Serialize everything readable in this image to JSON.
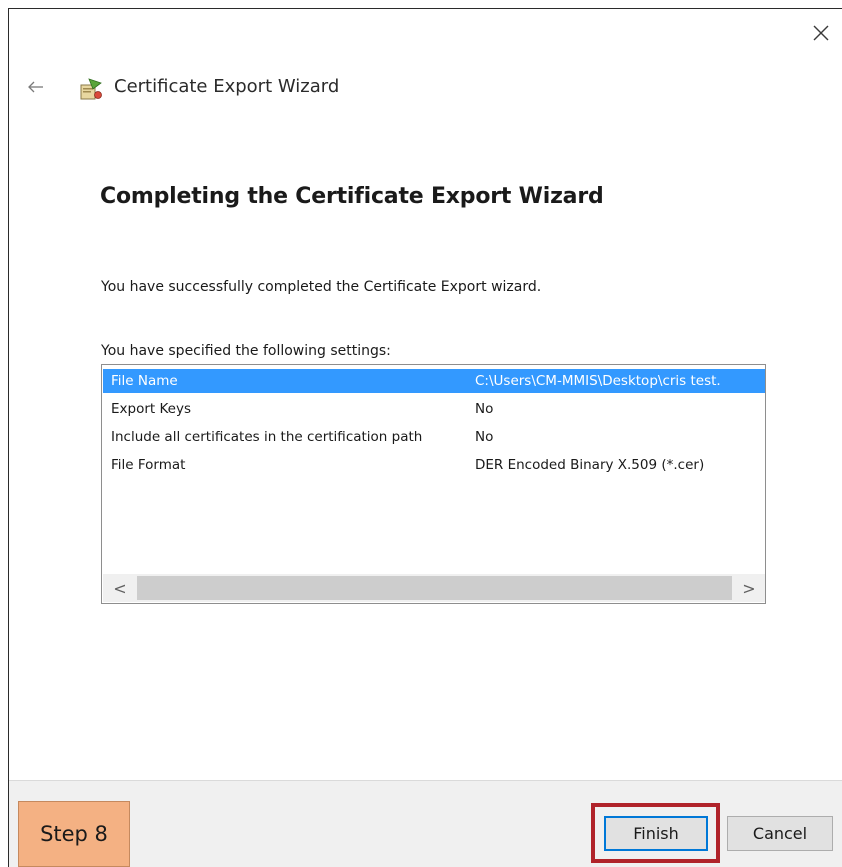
{
  "window": {
    "title": "Certificate Export Wizard",
    "close_icon": "close-icon",
    "back_icon": "back-arrow-icon",
    "wizard_icon": "certificate-wizard-icon"
  },
  "page": {
    "heading": "Completing the Certificate Export Wizard",
    "success_message": "You have successfully completed the Certificate Export wizard.",
    "settings_label": "You have specified the following settings:"
  },
  "settings": [
    {
      "name": "File Name",
      "value": "C:\\Users\\CM-MMIS\\Desktop\\cris test.",
      "selected": true
    },
    {
      "name": "Export Keys",
      "value": "No",
      "selected": false
    },
    {
      "name": "Include all certificates in the certification path",
      "value": "No",
      "selected": false
    },
    {
      "name": "File Format",
      "value": "DER Encoded Binary X.509 (*.cer)",
      "selected": false
    }
  ],
  "scrollbar": {
    "left_arrow": "<",
    "right_arrow": ">"
  },
  "buttons": {
    "finish": "Finish",
    "cancel": "Cancel"
  },
  "annotation": {
    "step_label": "Step 8",
    "badge_color": "#f4b183",
    "highlight_color": "#b0232a"
  },
  "colors": {
    "selection": "#3399ff",
    "focus_border": "#0078d7"
  }
}
